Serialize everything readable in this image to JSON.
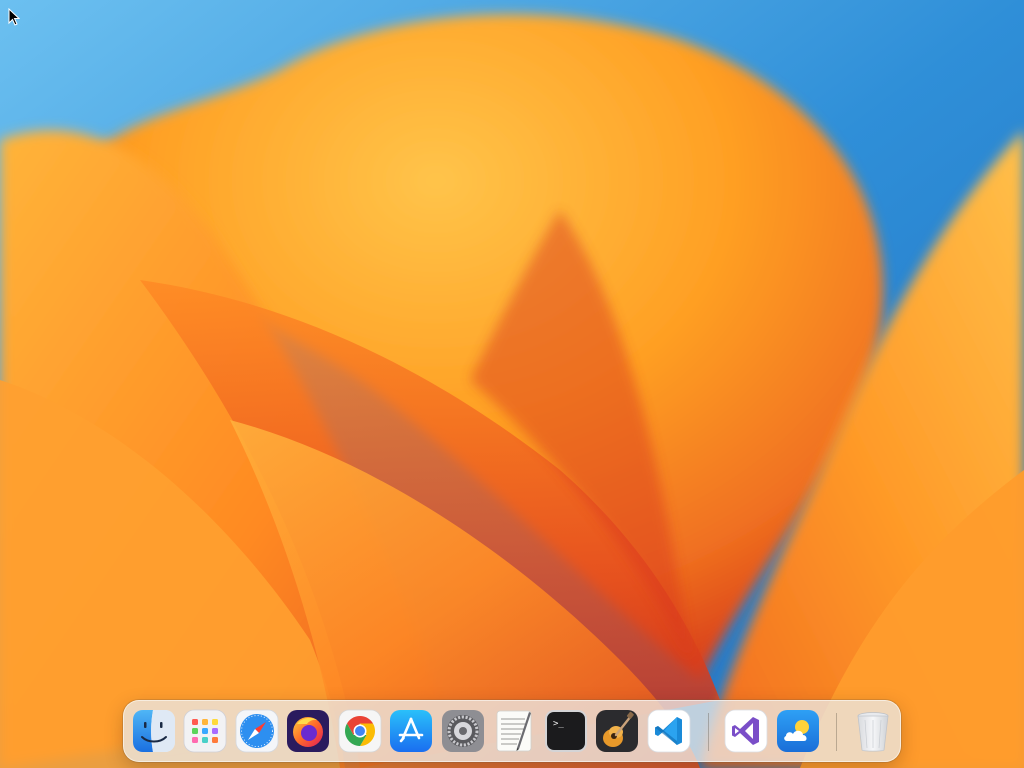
{
  "desktop": {
    "colors": {
      "sky": "#2f8fd8",
      "orange_light": "#ffc14a",
      "orange_mid": "#ff9a1f",
      "orange_deep": "#e8501e",
      "red_deep": "#c92a1c"
    }
  },
  "dock": {
    "apps": [
      {
        "id": "finder",
        "icon": "finder-icon"
      },
      {
        "id": "launchpad",
        "icon": "launchpad-icon"
      },
      {
        "id": "safari",
        "icon": "safari-icon"
      },
      {
        "id": "firefox",
        "icon": "firefox-icon"
      },
      {
        "id": "chrome",
        "icon": "chrome-icon"
      },
      {
        "id": "app-store",
        "icon": "app-store-icon"
      },
      {
        "id": "system-settings",
        "icon": "gear-icon"
      },
      {
        "id": "textedit",
        "icon": "textedit-icon"
      },
      {
        "id": "terminal",
        "icon": "terminal-icon",
        "glyph": ">_"
      },
      {
        "id": "garageband",
        "icon": "guitar-icon"
      },
      {
        "id": "vscode",
        "icon": "vscode-icon"
      },
      {
        "id": "visual-studio",
        "icon": "visual-studio-icon"
      },
      {
        "id": "weather",
        "icon": "weather-icon"
      },
      {
        "id": "trash",
        "icon": "trash-icon"
      }
    ]
  }
}
